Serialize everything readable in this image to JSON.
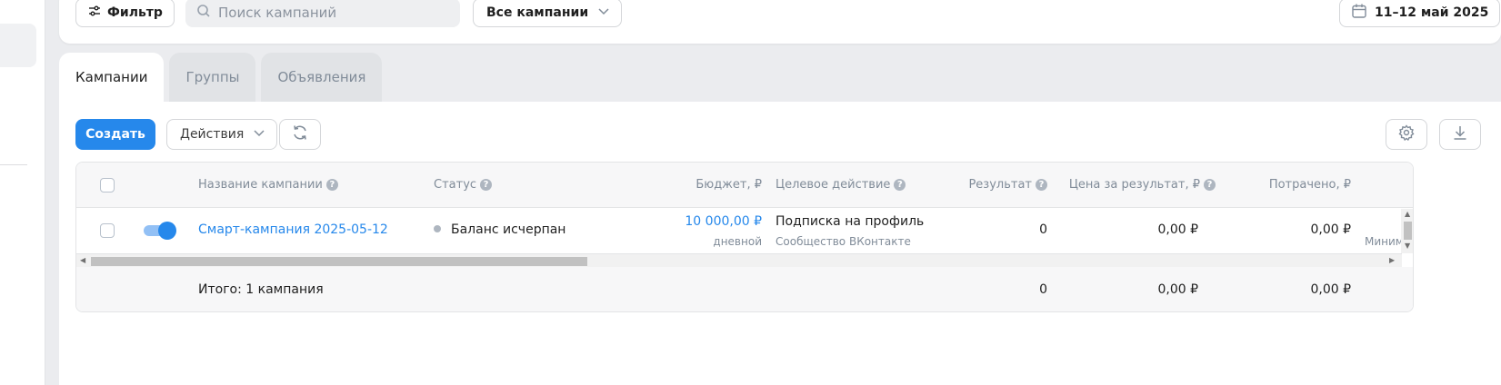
{
  "topbar": {
    "filter_label": "Фильтр",
    "search_placeholder": "Поиск кампаний",
    "campaign_select": "Все кампании",
    "date_range": "11–12 май 2025"
  },
  "tabs": [
    {
      "label": "Кампании",
      "active": true
    },
    {
      "label": "Группы",
      "active": false
    },
    {
      "label": "Объявления",
      "active": false
    }
  ],
  "toolbar": {
    "create_label": "Создать",
    "actions_label": "Действия"
  },
  "table": {
    "columns": [
      {
        "key": "name",
        "label": "Название кампании",
        "help": true
      },
      {
        "key": "status",
        "label": "Статус",
        "help": true
      },
      {
        "key": "budget",
        "label": "Бюджет, ₽",
        "help": false
      },
      {
        "key": "target",
        "label": "Целевое действие",
        "help": true
      },
      {
        "key": "result",
        "label": "Результат",
        "help": true
      },
      {
        "key": "cpr",
        "label": "Цена за результат, ₽",
        "help": true
      },
      {
        "key": "spent",
        "label": "Потрачено, ₽",
        "help": false
      }
    ],
    "rows": [
      {
        "enabled": true,
        "name": "Смарт-кампания 2025-05-12",
        "status": "Баланс исчерпан",
        "budget": "10 000,00 ₽",
        "budget_period": "дневной",
        "target": "Подписка на профиль",
        "target_sub": "Сообщество ВКонтакте",
        "result": "0",
        "cpr": "0,00 ₽",
        "spent": "0,00 ₽",
        "overflow_text": "Миним"
      }
    ],
    "totals": {
      "label": "Итого: 1 кампания",
      "result": "0",
      "cpr": "0,00 ₽",
      "spent": "0,00 ₽"
    }
  },
  "colors": {
    "accent": "#2688eb",
    "muted": "#818c99",
    "background": "#ebecef"
  },
  "icons": [
    "sliders-icon",
    "search-icon",
    "chevron-down-icon",
    "calendar-icon",
    "refresh-icon",
    "gear-icon",
    "download-icon",
    "help-icon"
  ]
}
